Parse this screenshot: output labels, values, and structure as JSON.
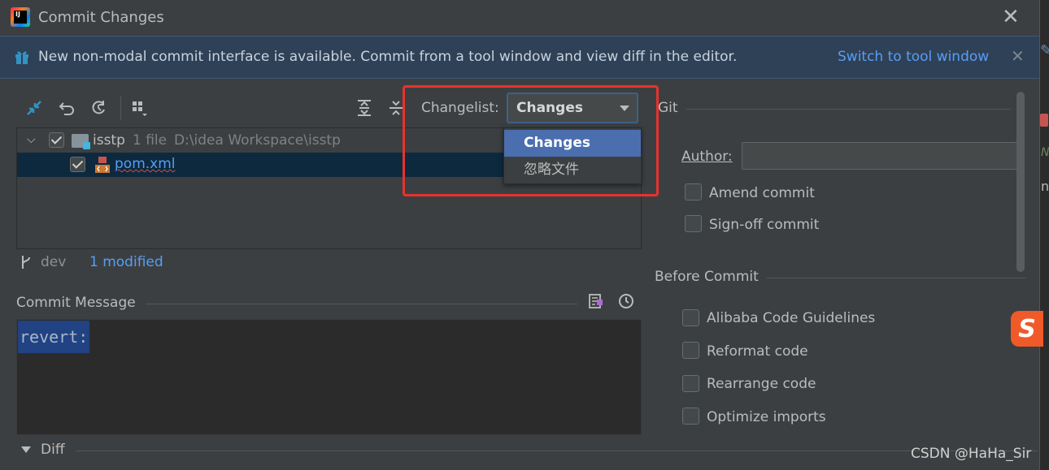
{
  "window": {
    "title": "Commit Changes",
    "close_glyph": "✕"
  },
  "banner": {
    "message": "New non-modal commit interface is available. Commit from a tool window and view diff in the editor.",
    "link": "Switch to tool window",
    "close_glyph": "✕"
  },
  "tree": {
    "root": {
      "name": "isstp",
      "count": "1 file",
      "path": "D:\\idea Workspace\\isstp",
      "checked": true
    },
    "files": [
      {
        "name": "pom.xml",
        "checked": true
      }
    ]
  },
  "status": {
    "branch": "dev",
    "modified": "1 modified"
  },
  "commit_message": {
    "label": "Commit Message",
    "value": "revert:"
  },
  "diff": {
    "label": "Diff"
  },
  "changelist": {
    "label": "Changelist:",
    "selected": "Changes",
    "options": [
      "Changes",
      "忽略文件"
    ]
  },
  "git": {
    "label": "Git",
    "author_label": "Author:",
    "author_value": "",
    "amend_label": "Amend commit",
    "signoff_label": "Sign-off commit"
  },
  "before_commit": {
    "label": "Before Commit",
    "options": [
      "Alibaba Code Guidelines",
      "Reformat code",
      "Rearrange code",
      "Optimize imports"
    ]
  },
  "watermark": "CSDN @HaHa_Sir",
  "colors": {
    "accent": "#589df6",
    "selection": "#4b6eaf",
    "highlight_border": "#e8322e",
    "background": "#3c3f41"
  }
}
